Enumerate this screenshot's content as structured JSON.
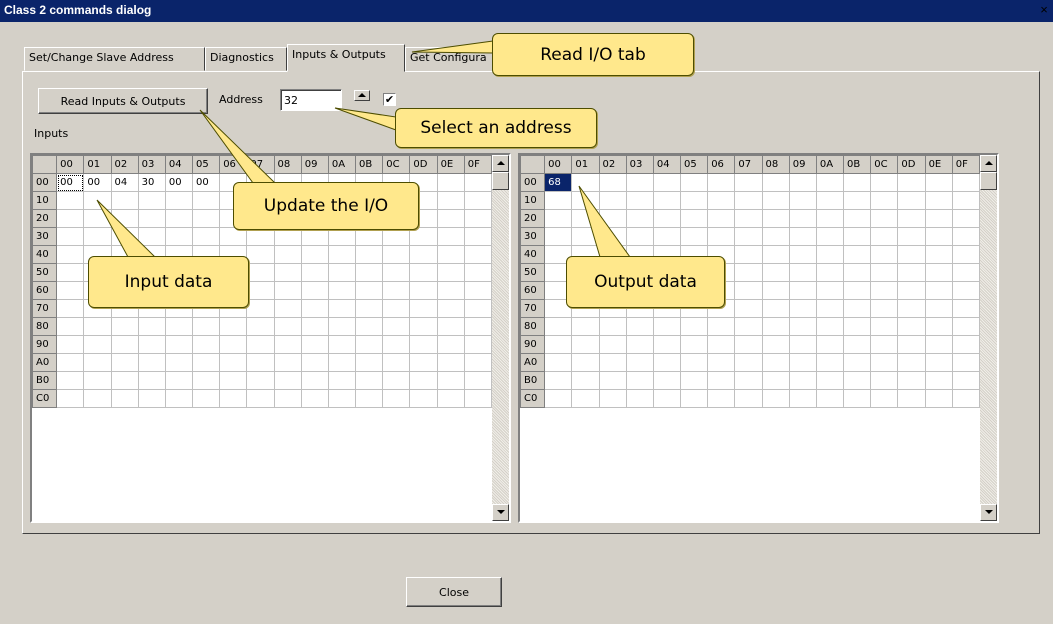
{
  "window": {
    "title": "Class 2 commands dialog",
    "close_glyph": "×"
  },
  "tabs": [
    {
      "label": "Set/Change Slave Address"
    },
    {
      "label": "Diagnostics"
    },
    {
      "label": "Inputs & Outputs"
    },
    {
      "label": "Get Configura"
    }
  ],
  "toolbar": {
    "read_button": "Read Inputs & Outputs",
    "address_label": "Address",
    "address_value": "32",
    "update_checkbox_checked": true,
    "update_checkbox_mark": "✔"
  },
  "inputs_panel": {
    "label": "Inputs"
  },
  "grid": {
    "column_headers": [
      "00",
      "01",
      "02",
      "03",
      "04",
      "05",
      "06",
      "07",
      "08",
      "09",
      "0A",
      "0B",
      "0C",
      "0D",
      "0E",
      "0F"
    ],
    "row_headers": [
      "00",
      "10",
      "20",
      "30",
      "40",
      "50",
      "60",
      "70",
      "80",
      "90",
      "A0",
      "B0",
      "C0"
    ]
  },
  "inputs_data": {
    "row_00": [
      "00",
      "00",
      "04",
      "30",
      "00",
      "00"
    ]
  },
  "outputs_data": {
    "row_00": [
      "68"
    ]
  },
  "footer": {
    "close_button": "Close"
  },
  "callouts": {
    "read_io_tab": "Read I/O tab",
    "select_address": "Select an address",
    "update_io": "Update the I/O",
    "input_data": "Input data",
    "output_data": "Output data"
  },
  "colors": {
    "titlebar": "#0a246a",
    "dialog_bg": "#d4d0c8",
    "callout": "#ffe88c",
    "selected_cell": "#0a246a"
  }
}
